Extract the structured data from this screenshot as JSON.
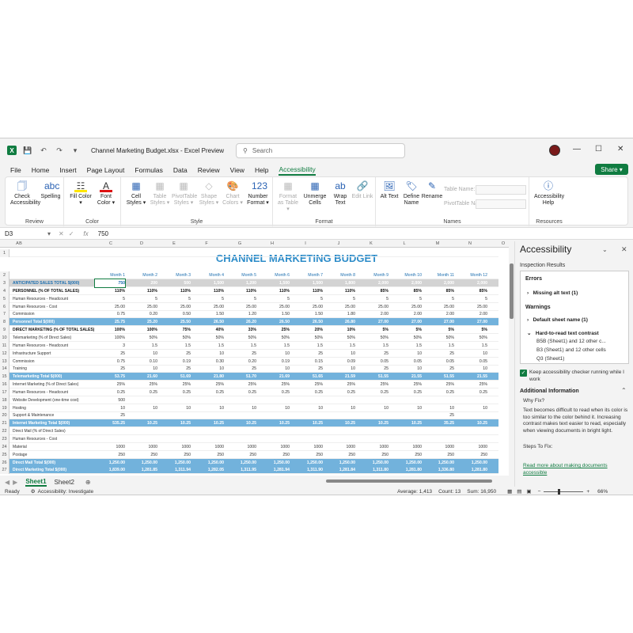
{
  "window": {
    "title": "Channel Marketing Budget.xlsx  -  Excel Preview",
    "search_placeholder": "Search",
    "minimize": "—",
    "maximize": "☐",
    "close": "✕"
  },
  "menu": [
    "File",
    "Home",
    "Insert",
    "Page Layout",
    "Formulas",
    "Data",
    "Review",
    "View",
    "Help",
    "Accessibility"
  ],
  "share_label": "Share ▾",
  "ribbon": {
    "review": {
      "label": "Review",
      "buttons": [
        "Check Accessibility",
        "Spelling"
      ]
    },
    "color": {
      "label": "Color",
      "buttons": [
        "Fill Color ▾",
        "Font Color ▾"
      ]
    },
    "style": {
      "label": "Style",
      "buttons": [
        "Cell Styles ▾",
        "Table Styles ▾",
        "PivotTable Styles ▾",
        "Shape Styles ▾",
        "Chart Colors ▾",
        "Number Format ▾"
      ]
    },
    "format": {
      "label": "Format",
      "buttons": [
        "Format as Table ▾",
        "Unmerge Cells",
        "Wrap Text",
        "Edit Link"
      ]
    },
    "names": {
      "label": "Names",
      "buttons": [
        "Alt Text",
        "Define Name",
        "Rename"
      ],
      "table_name": "Table Name:",
      "pivot_name": "PivotTable Name:"
    },
    "resources": {
      "label": "Resources",
      "buttons": [
        "Accessibility Help"
      ]
    }
  },
  "formula": {
    "namebox": "D3",
    "value": "750"
  },
  "sheet_title": "CHANNEL MARKETING BUDGET",
  "columns": [
    "A",
    "B",
    "C",
    "D",
    "E",
    "F",
    "G",
    "H",
    "I",
    "J",
    "K",
    "L",
    "M",
    "N",
    "O"
  ],
  "months": [
    "Month 1",
    "Month 2",
    "Month 3",
    "Month 4",
    "Month 5",
    "Month 6",
    "Month 7",
    "Month 8",
    "Month 9",
    "Month 10",
    "Month 11",
    "Month 12"
  ],
  "rows": [
    {
      "n": "3",
      "label": "ANTICIPATED SALES TOTAL $(000)",
      "type": "anticip",
      "v": [
        "750",
        "200",
        "500",
        "1,500",
        "1,200",
        "1,500",
        "1,500",
        "1,800",
        "2,000",
        "2,000",
        "2,000",
        "2,000"
      ]
    },
    {
      "n": "4",
      "label": "PERSONNEL (% OF TOTAL SALES)",
      "type": "bold",
      "v": [
        "110%",
        "110%",
        "110%",
        "110%",
        "110%",
        "110%",
        "110%",
        "110%",
        "85%",
        "85%",
        "85%",
        "85%"
      ]
    },
    {
      "n": "5",
      "label": "Human Resources - Headcount",
      "type": "",
      "v": [
        "5",
        "5",
        "5",
        "5",
        "5",
        "5",
        "5",
        "5",
        "5",
        "5",
        "5",
        "5"
      ]
    },
    {
      "n": "6",
      "label": "Human Resources - Cost",
      "type": "",
      "v": [
        "25.00",
        "25.00",
        "25.00",
        "25.00",
        "25.00",
        "25.00",
        "25.00",
        "25.00",
        "25.00",
        "25.00",
        "25.00",
        "25.00"
      ]
    },
    {
      "n": "7",
      "label": "Commission",
      "type": "",
      "v": [
        "0.75",
        "0.20",
        "0.50",
        "1.50",
        "1.20",
        "1.50",
        "1.50",
        "1.80",
        "2.00",
        "2.00",
        "2.00",
        "2.00"
      ]
    },
    {
      "n": "8",
      "label": "Personnel Total $(000)",
      "type": "sum",
      "v": [
        "25.75",
        "25.20",
        "25.50",
        "26.50",
        "26.20",
        "26.50",
        "26.50",
        "26.80",
        "27.00",
        "27.00",
        "27.00",
        "27.00"
      ]
    },
    {
      "n": "9",
      "label": "DIRECT MARKETING (% OF TOTAL SALES)",
      "type": "bold",
      "v": [
        "100%",
        "100%",
        "75%",
        "40%",
        "33%",
        "25%",
        "20%",
        "10%",
        "5%",
        "5%",
        "5%",
        "5%"
      ]
    },
    {
      "n": "10",
      "label": "Telemarketing (% of Direct Sales)",
      "type": "",
      "v": [
        "100%",
        "50%",
        "50%",
        "50%",
        "50%",
        "50%",
        "50%",
        "50%",
        "50%",
        "50%",
        "50%",
        "50%"
      ]
    },
    {
      "n": "11",
      "label": "Human Resources - Headcount",
      "type": "",
      "v": [
        "3",
        "1.5",
        "1.5",
        "1.5",
        "1.5",
        "1.5",
        "1.5",
        "1.5",
        "1.5",
        "1.5",
        "1.5",
        "1.5"
      ]
    },
    {
      "n": "12",
      "label": "Infrastructure Support",
      "type": "",
      "v": [
        "25",
        "10",
        "25",
        "10",
        "25",
        "10",
        "25",
        "10",
        "25",
        "10",
        "25",
        "10"
      ]
    },
    {
      "n": "13",
      "label": "Commission",
      "type": "",
      "v": [
        "0.75",
        "0.10",
        "0.19",
        "0.30",
        "0.20",
        "0.19",
        "0.15",
        "0.09",
        "0.05",
        "0.05",
        "0.05",
        "0.05"
      ]
    },
    {
      "n": "14",
      "label": "Training",
      "type": "",
      "v": [
        "25",
        "10",
        "25",
        "10",
        "25",
        "10",
        "25",
        "10",
        "25",
        "10",
        "25",
        "10"
      ]
    },
    {
      "n": "15",
      "label": "Telemarketing Total $(000)",
      "type": "sum",
      "v": [
        "53.75",
        "21.60",
        "51.69",
        "21.80",
        "51.70",
        "21.69",
        "51.65",
        "21.59",
        "51.55",
        "21.55",
        "51.55",
        "21.55"
      ]
    },
    {
      "n": "16",
      "label": "Internet Marketing (% of Direct Sales)",
      "type": "",
      "v": [
        "25%",
        "25%",
        "25%",
        "25%",
        "25%",
        "25%",
        "25%",
        "25%",
        "25%",
        "25%",
        "25%",
        "25%"
      ]
    },
    {
      "n": "17",
      "label": "Human Resources - Headcount",
      "type": "",
      "v": [
        "0.25",
        "0.25",
        "0.25",
        "0.25",
        "0.25",
        "0.25",
        "0.25",
        "0.25",
        "0.25",
        "0.25",
        "0.25",
        "0.25"
      ]
    },
    {
      "n": "18",
      "label": "Website Development (one-time cost)",
      "type": "",
      "v": [
        "500",
        "",
        "",
        "",
        "",
        "",
        "",
        "",
        "",
        "",
        "",
        ""
      ]
    },
    {
      "n": "19",
      "label": "Hosting",
      "type": "",
      "v": [
        "10",
        "10",
        "10",
        "10",
        "10",
        "10",
        "10",
        "10",
        "10",
        "10",
        "10",
        "10"
      ]
    },
    {
      "n": "20",
      "label": "Support & Maintenance",
      "type": "",
      "v": [
        "25",
        "",
        "",
        "",
        "",
        "",
        "",
        "",
        "",
        "",
        "25",
        ""
      ]
    },
    {
      "n": "21",
      "label": "Internet Marketing Total $(000)",
      "type": "sum",
      "v": [
        "535.25",
        "10.25",
        "10.25",
        "10.25",
        "10.25",
        "10.25",
        "10.25",
        "10.25",
        "10.25",
        "10.25",
        "35.25",
        "10.25"
      ]
    },
    {
      "n": "22",
      "label": "Direct Mail (% of Direct Sales)",
      "type": "",
      "v": [
        "",
        "",
        "",
        "",
        "",
        "",
        "",
        "",
        "",
        "",
        "",
        ""
      ]
    },
    {
      "n": "23",
      "label": "Human Resources - Cost",
      "type": "",
      "v": [
        "",
        "",
        "",
        "",
        "",
        "",
        "",
        "",
        "",
        "",
        "",
        ""
      ]
    },
    {
      "n": "24",
      "label": "Material",
      "type": "",
      "v": [
        "1000",
        "1000",
        "1000",
        "1000",
        "1000",
        "1000",
        "1000",
        "1000",
        "1000",
        "1000",
        "1000",
        "1000"
      ]
    },
    {
      "n": "25",
      "label": "Postage",
      "type": "",
      "v": [
        "250",
        "250",
        "250",
        "250",
        "250",
        "250",
        "250",
        "250",
        "250",
        "250",
        "250",
        "250"
      ]
    },
    {
      "n": "26",
      "label": "Direct Mail Total $(000)",
      "type": "sum",
      "v": [
        "1,250.00",
        "1,250.00",
        "1,250.00",
        "1,250.00",
        "1,250.00",
        "1,250.00",
        "1,250.00",
        "1,250.00",
        "1,250.00",
        "1,250.00",
        "1,250.00",
        "1,250.00"
      ]
    },
    {
      "n": "27",
      "label": "Direct Marketing Total $(000)",
      "type": "sum",
      "v": [
        "1,839.00",
        "1,281.85",
        "1,311.94",
        "1,282.05",
        "1,311.95",
        "1,281.94",
        "1,311.90",
        "1,281.84",
        "1,311.80",
        "1,281.80",
        "1,336.80",
        "1,281.80"
      ]
    }
  ],
  "sheets": [
    "Sheet1",
    "Sheet2"
  ],
  "status": {
    "ready": "Ready",
    "accessibility": "Accessibility: Investigate",
    "average": "Average: 1,413",
    "count": "Count: 13",
    "sum": "Sum: 16,950",
    "zoom": "66%"
  },
  "pane": {
    "title": "Accessibility",
    "subtitle": "Inspection Results",
    "errors": "Errors",
    "missing_alt": "Missing alt text (1)",
    "warnings": "Warnings",
    "default_sheet": "Default sheet name (1)",
    "hard_contrast": "Hard-to-read text contrast",
    "contrast_items": [
      "B5B (Sheet1) and 12 other c...",
      "B3 (Sheet1) and 12 other cells",
      "Q3 (Sheet1)"
    ],
    "keep_running": "Keep accessibility checker running while I work",
    "additional": "Additional Information",
    "why_fix": "Why Fix?",
    "why_text": "Text becomes difficult to read when its color is too similar to the color behind it. Increasing contrast makes text easier to read, especially when viewing documents in bright light.",
    "steps": "Steps To Fix:",
    "link": "Read more about making documents accessible"
  }
}
